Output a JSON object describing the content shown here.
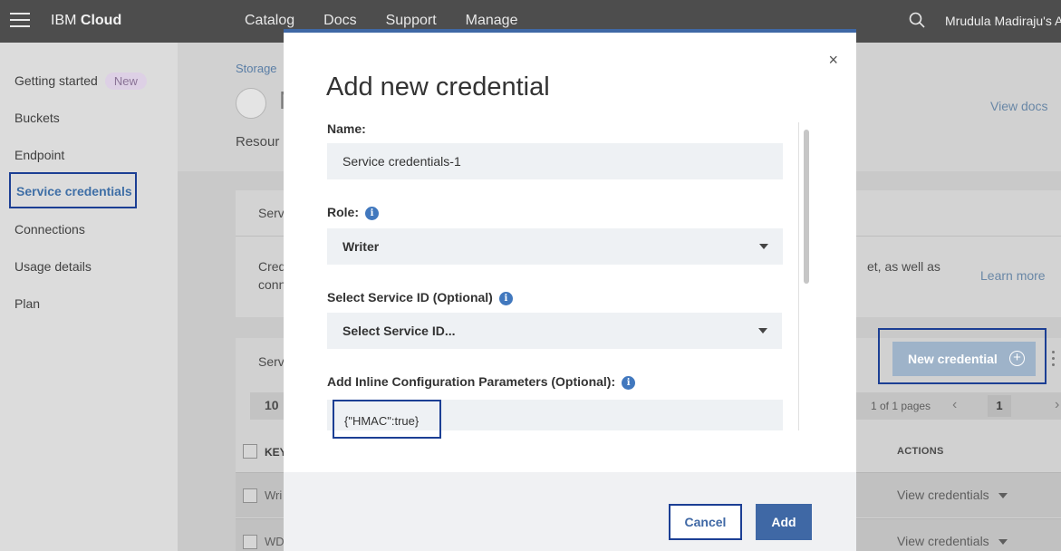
{
  "topbar": {
    "brand_prefix": "IBM",
    "brand_suffix": "Cloud",
    "nav": [
      "Catalog",
      "Docs",
      "Support",
      "Manage"
    ],
    "user": "Mrudula Madiraju's A"
  },
  "sidebar": {
    "items": [
      {
        "label": "Getting started",
        "badge": "New"
      },
      {
        "label": "Buckets"
      },
      {
        "label": "Endpoint"
      },
      {
        "label": "Service credentials",
        "active": true
      },
      {
        "label": "Connections"
      },
      {
        "label": "Usage details"
      },
      {
        "label": "Plan"
      }
    ]
  },
  "background": {
    "breadcrumb": "Storage",
    "service_initial": "N",
    "resource_label": "Resour",
    "view_docs": "View docs",
    "panel_title": "Serv",
    "panel_desc_line1": "Cred",
    "panel_desc_line2": "conn",
    "panel_desc_right": "et, as well as",
    "learn_more": "Learn more",
    "table_title": "Serv",
    "rows_per_page": "10",
    "pages_text": "1 of 1 pages",
    "current_page": "1",
    "col_key": "KEY",
    "col_actions": "ACTIONS",
    "rows": [
      {
        "key": "Wri",
        "action": "View credentials"
      },
      {
        "key": "WD",
        "action": "View credentials"
      }
    ],
    "new_credential_label": "New credential"
  },
  "modal": {
    "title": "Add new credential",
    "close": "×",
    "name_label": "Name:",
    "name_value": "Service credentials-1",
    "role_label": "Role:",
    "role_value": "Writer",
    "service_id_label": "Select Service ID (Optional)",
    "service_id_value": "Select Service ID...",
    "inline_label": "Add Inline Configuration Parameters (Optional):",
    "inline_value": "{\"HMAC\":true}",
    "cancel_label": "Cancel",
    "add_label": "Add"
  },
  "colors": {
    "topbar": "#4d4d4d",
    "accent": "#3f68a5",
    "highlight_box": "#1c3f94"
  }
}
